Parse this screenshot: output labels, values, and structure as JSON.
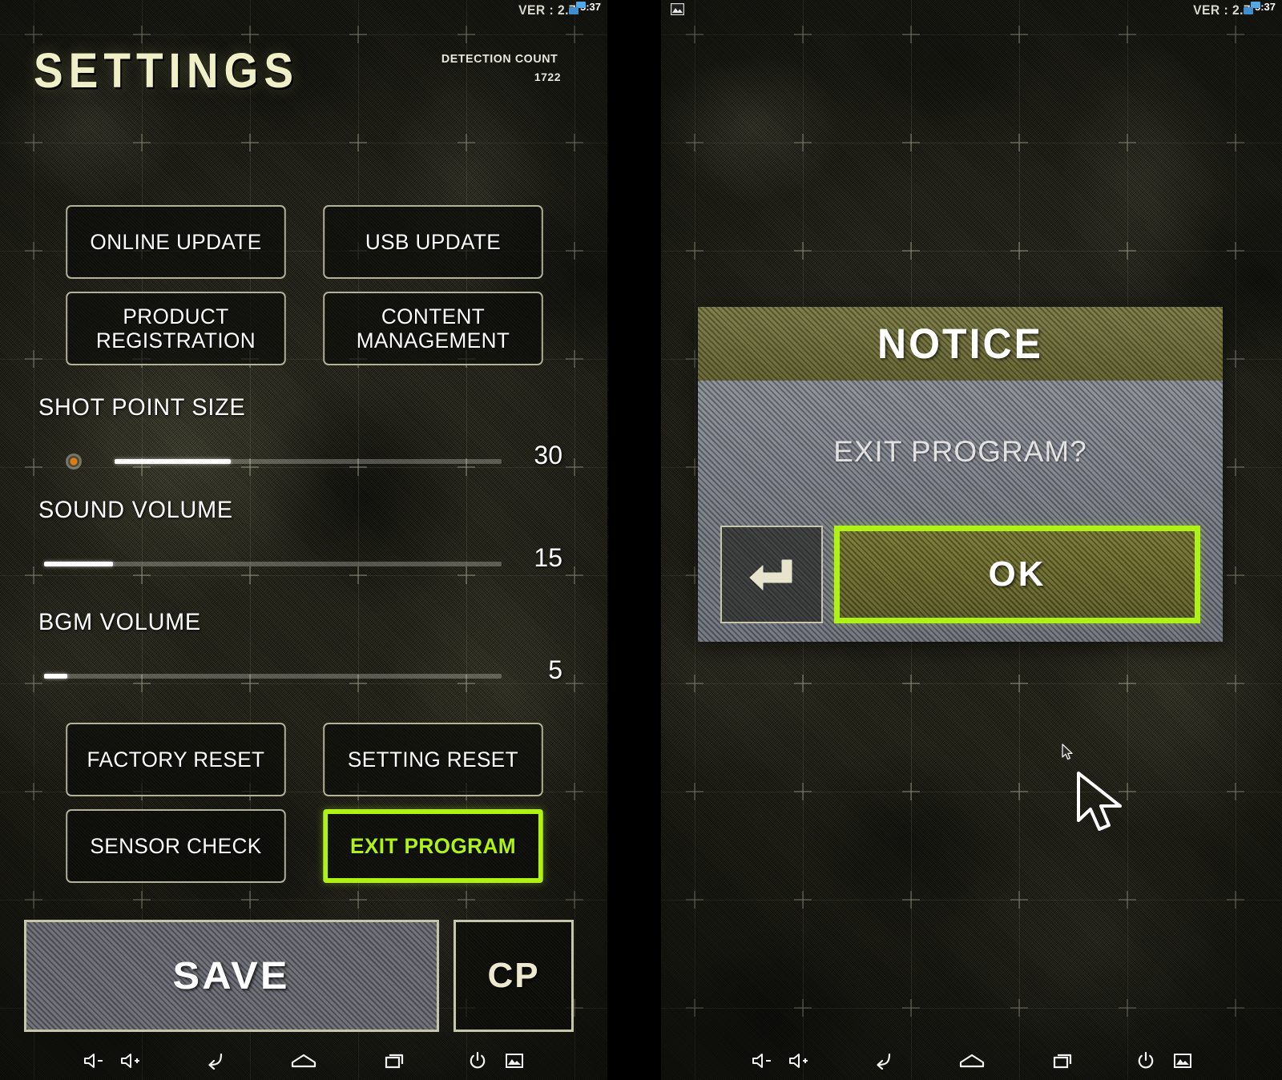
{
  "statusbar": {
    "version_text": "VER : 2.7",
    "clock": "5:37",
    "network_icon": "network-icon",
    "screenshot_icon": "screenshot-icon"
  },
  "header": {
    "title": "SETTINGS",
    "detection_label": "DETECTION COUNT",
    "detection_value": "1722"
  },
  "buttons_top": [
    {
      "label": "ONLINE UPDATE",
      "name": "online-update-button",
      "highlight": false
    },
    {
      "label": "USB UPDATE",
      "name": "usb-update-button",
      "highlight": false
    },
    {
      "label": "PRODUCT\nREGISTRATION",
      "name": "product-registration-button",
      "highlight": false
    },
    {
      "label": "CONTENT\nMANAGEMENT",
      "name": "content-management-button",
      "highlight": false
    }
  ],
  "buttons_bottom": [
    {
      "label": "FACTORY RESET",
      "name": "factory-reset-button",
      "highlight": false
    },
    {
      "label": "SETTING RESET",
      "name": "setting-reset-button",
      "highlight": false
    },
    {
      "label": "SENSOR CHECK",
      "name": "sensor-check-button",
      "highlight": false
    },
    {
      "label": "EXIT PROGRAM",
      "name": "exit-program-button",
      "highlight": true
    }
  ],
  "sliders": [
    {
      "label": "SHOT POINT SIZE",
      "value": "30",
      "percent": 30,
      "has_dot": true,
      "name": "shot-point-size"
    },
    {
      "label": "SOUND VOLUME",
      "value": "15",
      "percent": 15,
      "has_dot": false,
      "name": "sound-volume"
    },
    {
      "label": "BGM VOLUME",
      "value": "5",
      "percent": 5,
      "has_dot": false,
      "name": "bgm-volume"
    }
  ],
  "footer": {
    "save_label": "SAVE",
    "cp_label": "CP"
  },
  "dialog": {
    "title": "NOTICE",
    "message": "EXIT PROGRAM?",
    "back_icon": "back-arrow-icon",
    "ok_label": "OK"
  },
  "navbar": {
    "items": [
      {
        "name": "volume-down-icon"
      },
      {
        "name": "volume-up-icon"
      },
      {
        "name": "back-icon"
      },
      {
        "name": "home-icon"
      },
      {
        "name": "recents-icon"
      },
      {
        "name": "power-icon"
      },
      {
        "name": "screenshot-icon"
      }
    ]
  },
  "colors": {
    "accent_green": "#aef216",
    "title_cream": "#eff0c8",
    "dialog_header_olive": "#6d6d3d",
    "dialog_body_gray": "#7f838c",
    "shot_dot_orange": "#e07b14"
  }
}
